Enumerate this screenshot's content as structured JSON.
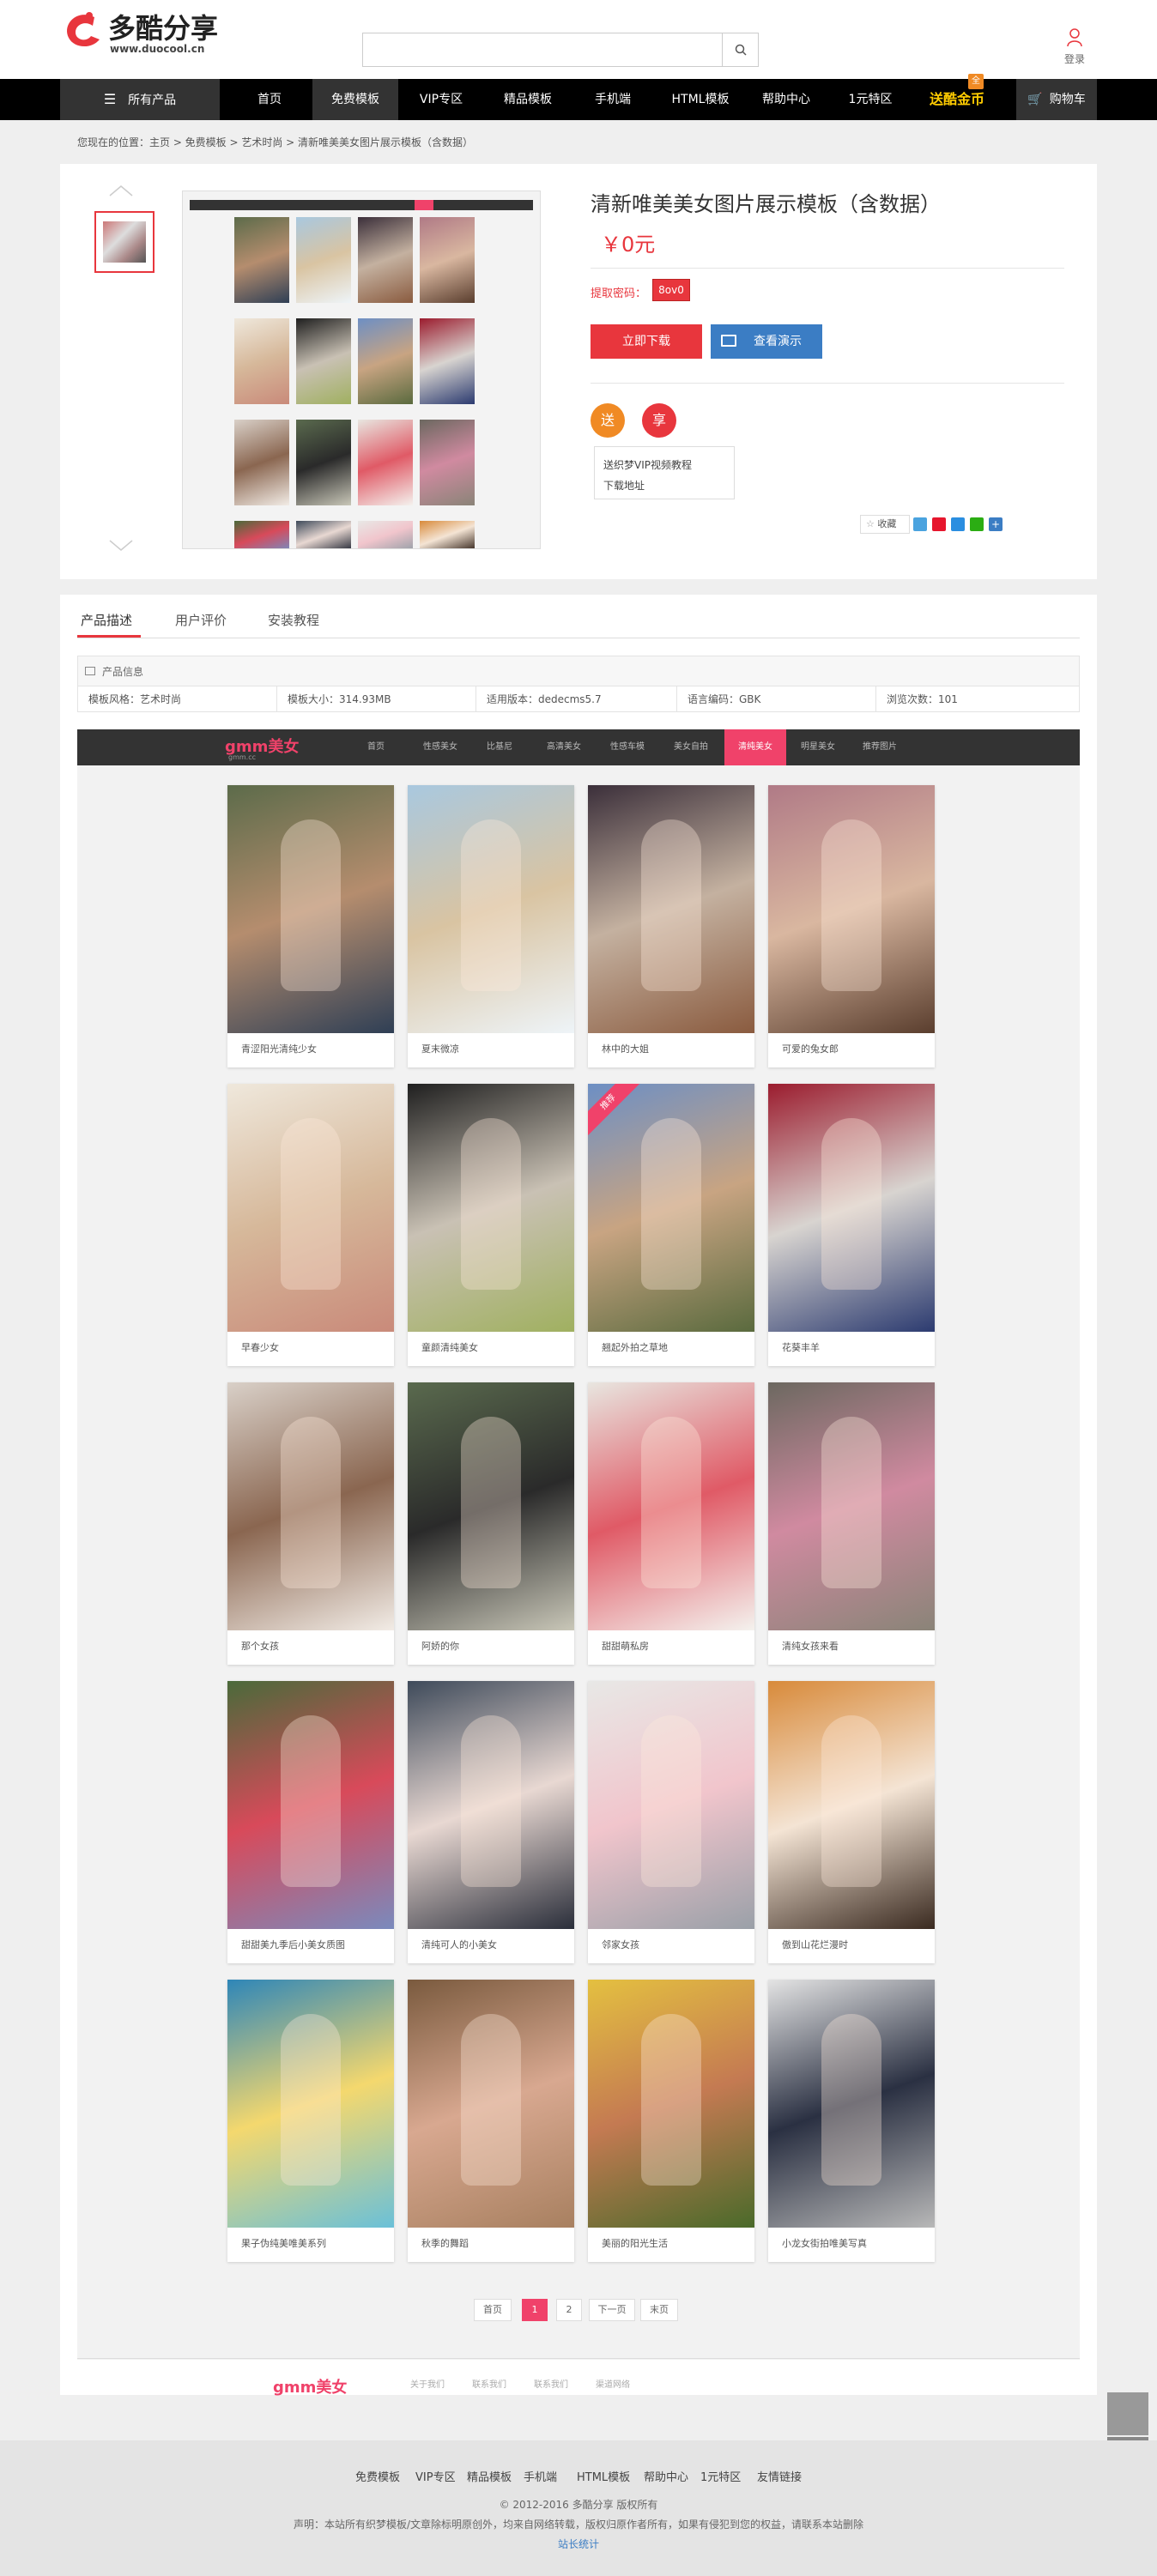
{
  "brand": {
    "name": "多酷分享",
    "site": "www.duocool.cn"
  },
  "header": {
    "search_placeholder": "",
    "login_label": "登录"
  },
  "nav": {
    "all_products": "所有产品",
    "items": [
      "首页",
      "免费模板",
      "VIP专区",
      "精品模板",
      "手机端",
      "HTML模板",
      "帮助中心",
      "1元特区"
    ],
    "coin_label": "送酷金币",
    "coin_badge": "全",
    "cart": "购物车"
  },
  "breadcrumb": "您现在的位置：主页 > 免费模板 > 艺术时尚 > 清新唯美美女图片展示模板（含数据）",
  "product": {
    "title": "清新唯美美女图片展示模板（含数据）",
    "price": "￥0元",
    "code_label": "提取密码：",
    "code_value": "8ov0",
    "download_btn": "立即下载",
    "demo_btn": "查看演示",
    "gift_icons": [
      "送",
      "享"
    ],
    "gift_lines": [
      "送织梦VIP视频教程",
      "下载地址"
    ],
    "favorite": "收藏"
  },
  "tabs": [
    "产品描述",
    "用户评价",
    "安装教程"
  ],
  "info": {
    "header": "产品信息",
    "cells": [
      "模板风格：艺术时尚",
      "模板大小：314.93MB",
      "适用版本：dedecms5.7",
      "语言编码：GBK",
      "浏览次数：101"
    ]
  },
  "preview": {
    "logo_main": "gmm美女",
    "logo_sub": "gmm.cc",
    "nav": [
      "首页",
      "性感美女",
      "比基尼",
      "高清美女",
      "性感车模",
      "美女自拍",
      "清纯美女",
      "明星美女",
      "推荐图片"
    ],
    "nav_active": 6,
    "tag": "推荐",
    "photos": [
      "青涩阳光清纯少女",
      "夏末微凉",
      "林中的大姐",
      "可爱的兔女郎",
      "早春少女",
      "童颜清纯美女",
      "翘起外拍之草地",
      "花葵丰羊",
      "那个女孩",
      "阿娇的你",
      "甜甜萌私房",
      "清纯女孩来看",
      "甜甜美九季后小美女质图",
      "清纯可人的小美女",
      "邻家女孩",
      "傲到山花烂漫时",
      "果子伪纯美唯美系列",
      "秋季的舞蹈",
      "美丽的阳光生活",
      "小龙女街拍唯美写真"
    ],
    "pagination": [
      "首页",
      "1",
      "2",
      "下一页",
      "末页"
    ],
    "footer_links": [
      "关于我们",
      "联系我们",
      "联系我们",
      "渠道网络"
    ]
  },
  "footer": {
    "links": [
      "免费模板",
      "VIP专区",
      "精品模板",
      "手机端",
      "HTML模板",
      "帮助中心",
      "1元特区",
      "友情链接"
    ],
    "copyright": "© 2012-2016 多酷分享 版权所有",
    "disclaimer": "声明：本站所有织梦模板/文章除标明原创外，均来自网络转载，版权归原作者所有，如果有侵犯到您的权益，请联系本站删除",
    "stats": "站长统计"
  },
  "colors": {
    "accent": "#e8363d",
    "blue": "#3b7dc4",
    "nav_bg": "#000",
    "pink": "#f0426a"
  }
}
